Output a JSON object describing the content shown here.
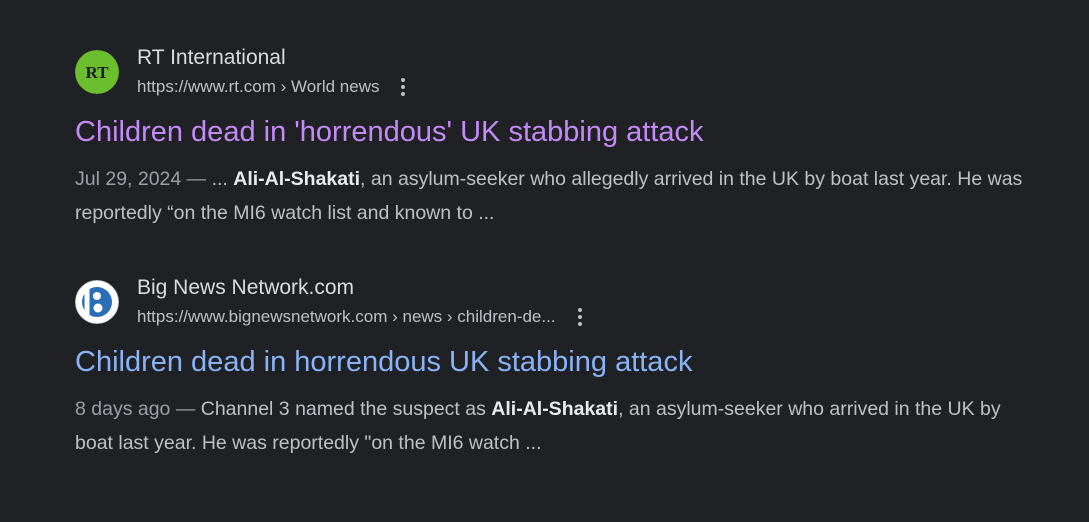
{
  "results": [
    {
      "site_name": "RT International",
      "url": "https://www.rt.com › World news",
      "favicon_text": "RT",
      "favicon_color": "#6bbf2e",
      "title": "Children dead in 'horrendous' UK stabbing attack",
      "title_color": "#c58af9",
      "date": "Jul 29, 2024 — ",
      "snippet_pre": "... ",
      "snippet_bold": "Ali-Al-Shakati",
      "snippet_post": ", an asylum-seeker who allegedly arrived in the UK by boat last year. He was reportedly “on the MI6 watch list and known to ..."
    },
    {
      "site_name": "Big News Network.com",
      "url": "https://www.bignewsnetwork.com › news › children-de...",
      "favicon_text": "B",
      "favicon_color": "#2a6fb5",
      "title": "Children dead in horrendous UK stabbing attack",
      "title_color": "#8ab4f8",
      "date": "8 days ago — ",
      "snippet_pre": "Channel 3 named the suspect as ",
      "snippet_bold": "Ali-Al-Shakati",
      "snippet_post": ", an asylum-seeker who arrived in the UK by boat last year. He was reportedly \"on the MI6 watch ..."
    }
  ]
}
